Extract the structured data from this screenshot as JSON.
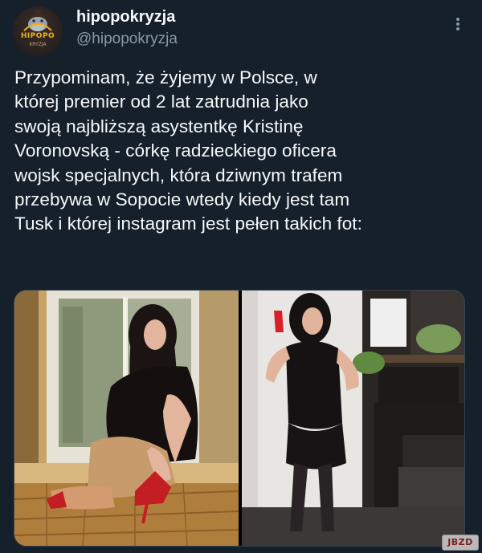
{
  "author": {
    "display_name": "hipopokryzja",
    "handle": "@hipopokryzja",
    "avatar_text_top": "HIPOPO",
    "avatar_text_bottom": "KRYZJA"
  },
  "tweet": {
    "lines": [
      "Przypominam, że żyjemy w Polsce, w",
      "której premier od 2 lat zatrudnia jako",
      "swoją najbliższą asystentkę Kristinę",
      "Voronovską - córkę radzieckiego oficera",
      "wojsk specjalnych, która dziwnym trafem",
      "przebywa w Sopocie wtedy kiedy jest tam",
      "Tusk i której instagram jest pełen takich fot:"
    ]
  },
  "media": {
    "count": 2,
    "photos": [
      "photo-1",
      "photo-2"
    ]
  },
  "watermark": {
    "text": "JBZD"
  },
  "colors": {
    "background": "#15202b",
    "text": "#f7f9f9",
    "secondary": "#8b98a5",
    "border": "#38444d"
  },
  "icons": {
    "more": "more-vertical-icon"
  }
}
